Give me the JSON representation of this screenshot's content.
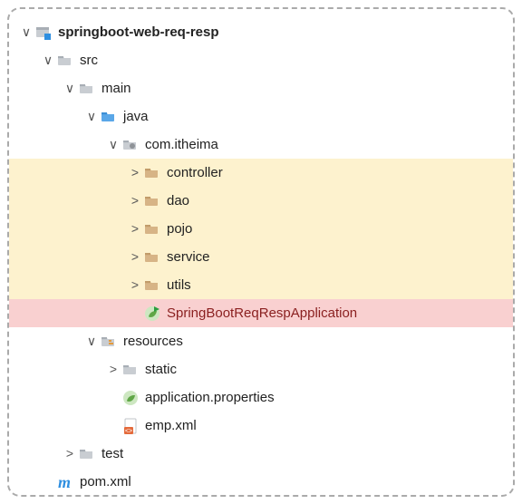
{
  "tree": {
    "root": {
      "label": "springboot-web-req-resp"
    },
    "src": {
      "label": "src"
    },
    "main": {
      "label": "main"
    },
    "java": {
      "label": "java"
    },
    "pkg": {
      "label": "com.itheima"
    },
    "controller": {
      "label": "controller"
    },
    "dao": {
      "label": "dao"
    },
    "pojo": {
      "label": "pojo"
    },
    "service": {
      "label": "service"
    },
    "utils": {
      "label": "utils"
    },
    "appclass": {
      "label": "SpringBootReqRespApplication"
    },
    "resources": {
      "label": "resources"
    },
    "static": {
      "label": "static"
    },
    "appprops": {
      "label": "application.properties"
    },
    "empxml": {
      "label": "emp.xml"
    },
    "test": {
      "label": "test"
    },
    "pom": {
      "label": "pom.xml"
    }
  }
}
